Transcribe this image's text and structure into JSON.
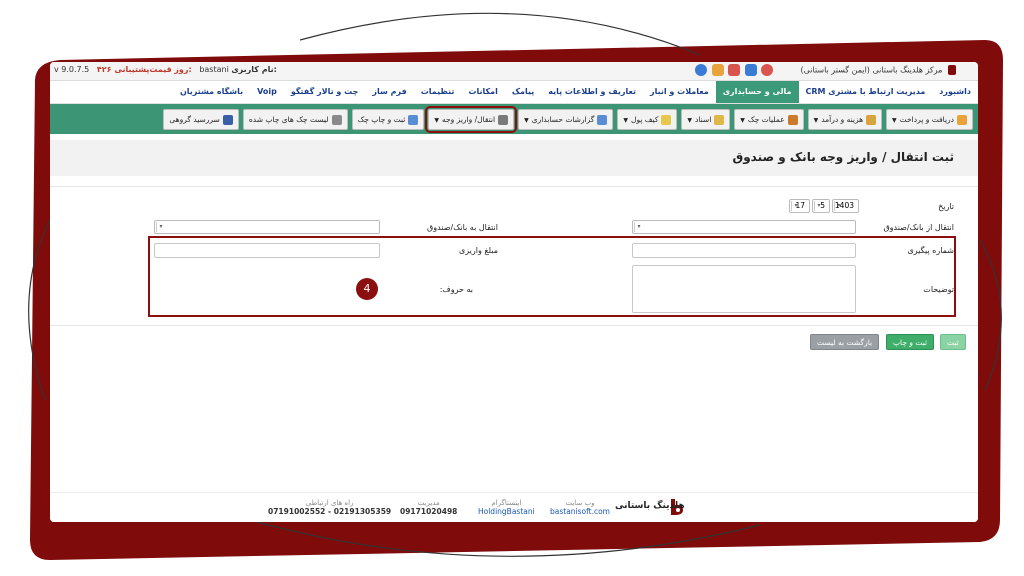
{
  "topbar": {
    "center_title": "مرکز هلدینگ باستانی (ایمن گستر باستانی)",
    "username_label": "نام کاربری:",
    "username": "bastani",
    "support_label": "قیمت‌پشتیبانی:",
    "support_value": "۴۲۶ روز",
    "version": "v 9.0.7.5"
  },
  "menu": {
    "items": [
      {
        "label": "داشبورد"
      },
      {
        "label": "مدیریت ارتباط با مشتری CRM"
      },
      {
        "label": "مالی و حسابداری",
        "active": true
      },
      {
        "label": "معاملات و انبار"
      },
      {
        "label": "تعاریف و اطلاعات پایه"
      },
      {
        "label": "پیامک"
      },
      {
        "label": "امکانات"
      },
      {
        "label": "تنظیمات"
      },
      {
        "label": "فرم ساز"
      },
      {
        "label": "چت و تالار گفتگو"
      },
      {
        "label": "Voip"
      },
      {
        "label": "باشگاه مشتریان"
      }
    ]
  },
  "toolbar": {
    "buttons": [
      {
        "label": "دریافت و پرداخت",
        "icon": "money-icon",
        "dropdown": true
      },
      {
        "label": "هزینه و درآمد",
        "icon": "coins-icon",
        "dropdown": true
      },
      {
        "label": "عملیات چک",
        "icon": "check-icon",
        "dropdown": true
      },
      {
        "label": "اسناد",
        "icon": "document-icon",
        "dropdown": true
      },
      {
        "label": "کیف پول",
        "icon": "wallet-icon",
        "dropdown": true
      },
      {
        "label": "گزارشات حسابداری",
        "icon": "report-icon",
        "dropdown": true
      },
      {
        "label": "انتقال/ واریز وجه",
        "icon": "transfer-icon",
        "dropdown": true,
        "highlighted": true
      },
      {
        "label": "ثبت و چاپ چک",
        "icon": "print-icon",
        "dropdown": false
      },
      {
        "label": "لیست چک های چاپ شده",
        "icon": "list-icon",
        "dropdown": false
      },
      {
        "label": "سررسید گروهی",
        "icon": "calendar-icon",
        "dropdown": false
      }
    ]
  },
  "page": {
    "title": "ثبت انتقال / واریز وجه بانک و صندوق"
  },
  "form": {
    "date_label": "تاریخ",
    "date_year": "1403",
    "date_month": "5",
    "date_day": "17",
    "from_label": "انتقال از بانک/صندوق",
    "to_label": "انتقال به بانک/صندوق",
    "tracking_label": "شماره پیگیری",
    "amount_label": "مبلغ واریزی",
    "description_label": "توضیحات",
    "words_label": "به حروف:",
    "step_number": "4"
  },
  "actions": {
    "submit": "ثبت",
    "submit_print": "ثبت و چاپ",
    "back": "بازگشت به لیست"
  },
  "footer": {
    "brand": "هلدینگ باستانی",
    "website_caption": "وب سایت",
    "website": "bastanisoft.com",
    "instagram_caption": "اینستاگرام",
    "instagram": "HoldingBastani",
    "manager_caption": "مدیریت",
    "manager": "09171020498",
    "contact_caption": "راه های ارتباطی",
    "contact": "07191002552 - 02191305359"
  },
  "colors": {
    "accent": "#3c9676",
    "frame": "#8b0f0f",
    "menu_text": "#1a3f8f"
  }
}
